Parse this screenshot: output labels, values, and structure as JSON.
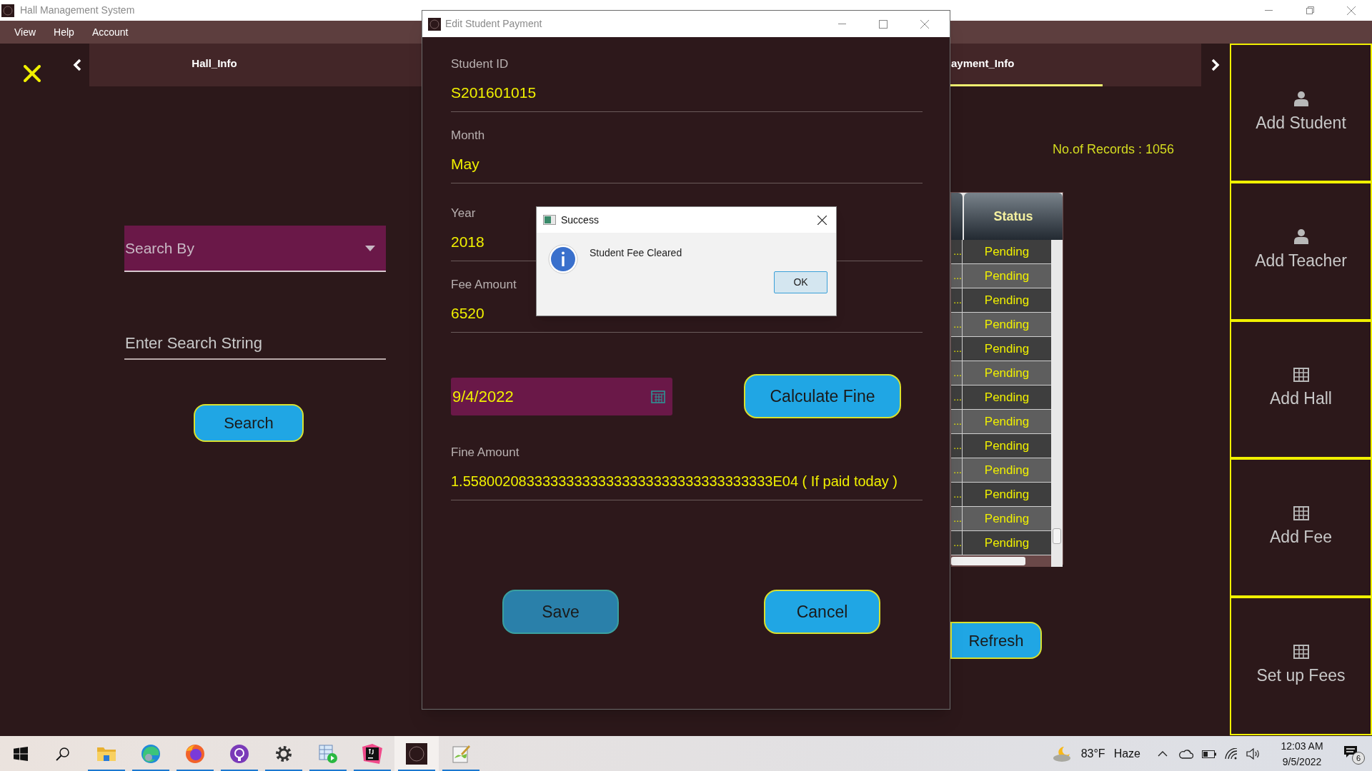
{
  "window": {
    "title": "Hall Management System"
  },
  "menu": [
    "View",
    "Help",
    "Account"
  ],
  "tabs": [
    {
      "label": "Hall_Info",
      "selected": false
    },
    {
      "label": "ayment_Info",
      "selected": true
    }
  ],
  "search": {
    "search_by": {
      "placeholder": "Search By"
    },
    "search_string": {
      "placeholder": "Enter Search String"
    },
    "button": "Search"
  },
  "records": "No.of Records : 1056",
  "table": {
    "columns": [
      "Status"
    ],
    "rows": [
      {
        "cell_1": "...",
        "status": "Pending"
      },
      {
        "cell_1": "...",
        "status": "Pending"
      },
      {
        "cell_1": "...",
        "status": "Pending"
      },
      {
        "cell_1": "...",
        "status": "Pending"
      },
      {
        "cell_1": "...",
        "status": "Pending"
      },
      {
        "cell_1": "...",
        "status": "Pending"
      },
      {
        "cell_1": "...",
        "status": "Pending"
      },
      {
        "cell_1": "...",
        "status": "Pending"
      },
      {
        "cell_1": "...",
        "status": "Pending"
      },
      {
        "cell_1": "...",
        "status": "Pending"
      },
      {
        "cell_1": "...",
        "status": "Pending"
      },
      {
        "cell_1": "...",
        "status": "Pending"
      },
      {
        "cell_1": "...",
        "status": "Pending"
      }
    ]
  },
  "refresh_button": "Refresh",
  "sidebar": [
    {
      "label": "Add Student",
      "kind": "person"
    },
    {
      "label": "Add Teacher",
      "kind": "person"
    },
    {
      "label": "Add Hall",
      "kind": "grid"
    },
    {
      "label": "Add Fee",
      "kind": "grid"
    },
    {
      "label": "Set up Fees",
      "kind": "grid"
    }
  ],
  "edit_dialog": {
    "title": "Edit Student Payment",
    "fields": [
      {
        "label": "Student ID",
        "value": "S201601015"
      },
      {
        "label": "Month",
        "value": "May"
      },
      {
        "label": "Year",
        "value": "2018"
      },
      {
        "label": "Fee Amount",
        "value": "6520"
      }
    ],
    "date": "9/4/2022",
    "calculate_button": "Calculate Fine",
    "fine": {
      "label": "Fine Amount",
      "value": "1.558002083333333333333333333333333333333E04 ( If paid today )"
    },
    "buttons": [
      {
        "label": "Save",
        "focused": true
      },
      {
        "label": "Cancel",
        "focused": false
      }
    ]
  },
  "message_dialog": {
    "title": "Success",
    "message": "Student Fee Cleared",
    "button": "OK"
  },
  "taskbar": {
    "items": [
      {
        "kind": "start",
        "running": false,
        "selected": false
      },
      {
        "kind": "search",
        "running": false,
        "selected": false
      },
      {
        "kind": "folder",
        "running": true,
        "selected": false
      },
      {
        "kind": "edge",
        "running": true,
        "selected": false
      },
      {
        "kind": "firefox",
        "running": true,
        "selected": false
      },
      {
        "kind": "github",
        "running": true,
        "selected": false
      },
      {
        "kind": "settings",
        "running": true,
        "selected": false
      },
      {
        "kind": "player",
        "running": true,
        "selected": false
      },
      {
        "kind": "ide",
        "running": true,
        "selected": false
      },
      {
        "kind": "app",
        "running": true,
        "selected": true
      },
      {
        "kind": "notepad",
        "running": true,
        "selected": false
      }
    ],
    "temperature": "83°F",
    "weather": "Haze",
    "time": "12:03 AM",
    "date": "9/5/2022",
    "notifications": "6"
  }
}
